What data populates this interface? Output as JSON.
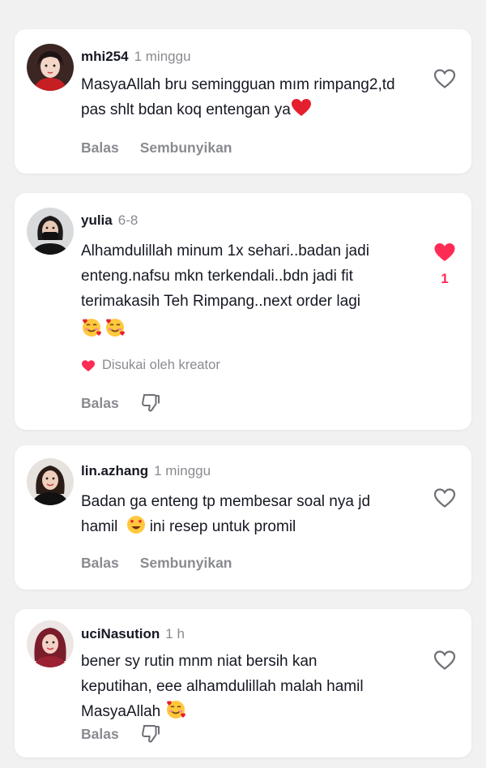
{
  "colors": {
    "accent": "#fe2c55",
    "muted": "#8a8b91",
    "text": "#161823"
  },
  "comments": [
    {
      "username": "mhi254",
      "time": "1 minggu",
      "text_lines": [
        "MasyaAllah bru semingguan mım rimpang2,td",
        "pas shlt bdan koq entengan ya"
      ],
      "trailing_emoji": "red-heart",
      "like_icon": "heart-outline-icon",
      "actions": [
        "Balas",
        "Sembunyikan"
      ]
    },
    {
      "username": "yulia",
      "time": "6-8",
      "text_lines": [
        "Alhamdulillah minum 1x sehari..badan jadi",
        "enteng.nafsu mkn terkendali..bdn jadi fit",
        "terimakasih Teh Rimpang..next order lagi"
      ],
      "emoji_line": [
        "smiling-hearts",
        "smiling-hearts"
      ],
      "liked": true,
      "like_count": "1",
      "like_icon": "heart-filled-icon",
      "creator_badge": "Disukai oleh kreator",
      "actions": [
        "Balas"
      ],
      "dislike_icon": "thumbs-down-icon"
    },
    {
      "username": "lin.azhang",
      "time": "1 minggu",
      "text_lines": [
        "Badan ga enteng tp membesar soal nya jd",
        "hamil"
      ],
      "inline_emoji": "heart-eyes",
      "line2_suffix": "ini resep untuk promil",
      "like_icon": "heart-outline-icon",
      "actions": [
        "Balas",
        "Sembunyikan"
      ]
    },
    {
      "username": "uciNasution",
      "time": "1 h",
      "text_lines": [
        "bener sy rutin mnm niat bersih kan",
        "keputihan, eee alhamdulillah malah hamil",
        "MasyaAllah"
      ],
      "trailing_emoji": "smiling-hearts",
      "like_icon": "heart-outline-icon",
      "actions": [
        "Balas"
      ],
      "dislike_icon": "thumbs-down-icon"
    }
  ]
}
